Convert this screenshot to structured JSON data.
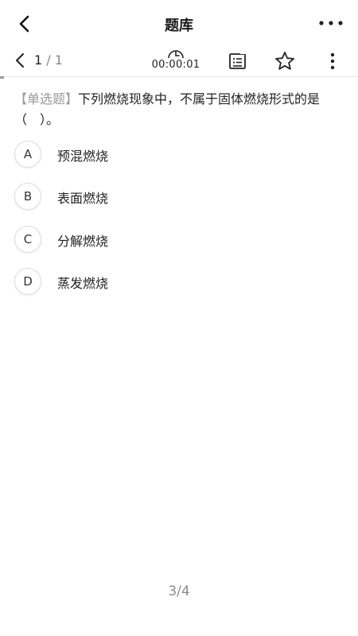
{
  "header": {
    "title": "题库",
    "back_icon": "chevron-left-icon",
    "more_icon": "more-horizontal-icon"
  },
  "toolbar": {
    "prev_icon": "chevron-left-icon",
    "current": "1",
    "separator": "/",
    "total": "1",
    "timer": "00:00:01",
    "answer_card_icon": "answer-sheet-icon",
    "favorite_icon": "star-outline-icon",
    "menu_icon": "more-vertical-icon"
  },
  "question": {
    "type": "【单选题】",
    "text": "下列燃烧现象中，不属于固体燃烧形式的是（　）。"
  },
  "options": [
    {
      "letter": "A",
      "text": "预混燃烧"
    },
    {
      "letter": "B",
      "text": "表面燃烧"
    },
    {
      "letter": "C",
      "text": "分解燃烧"
    },
    {
      "letter": "D",
      "text": "蒸发燃烧"
    }
  ],
  "pager": "3/4",
  "colors": {
    "text": "#222222",
    "muted": "#9a9a9a",
    "divider": "#e6e6e6"
  }
}
